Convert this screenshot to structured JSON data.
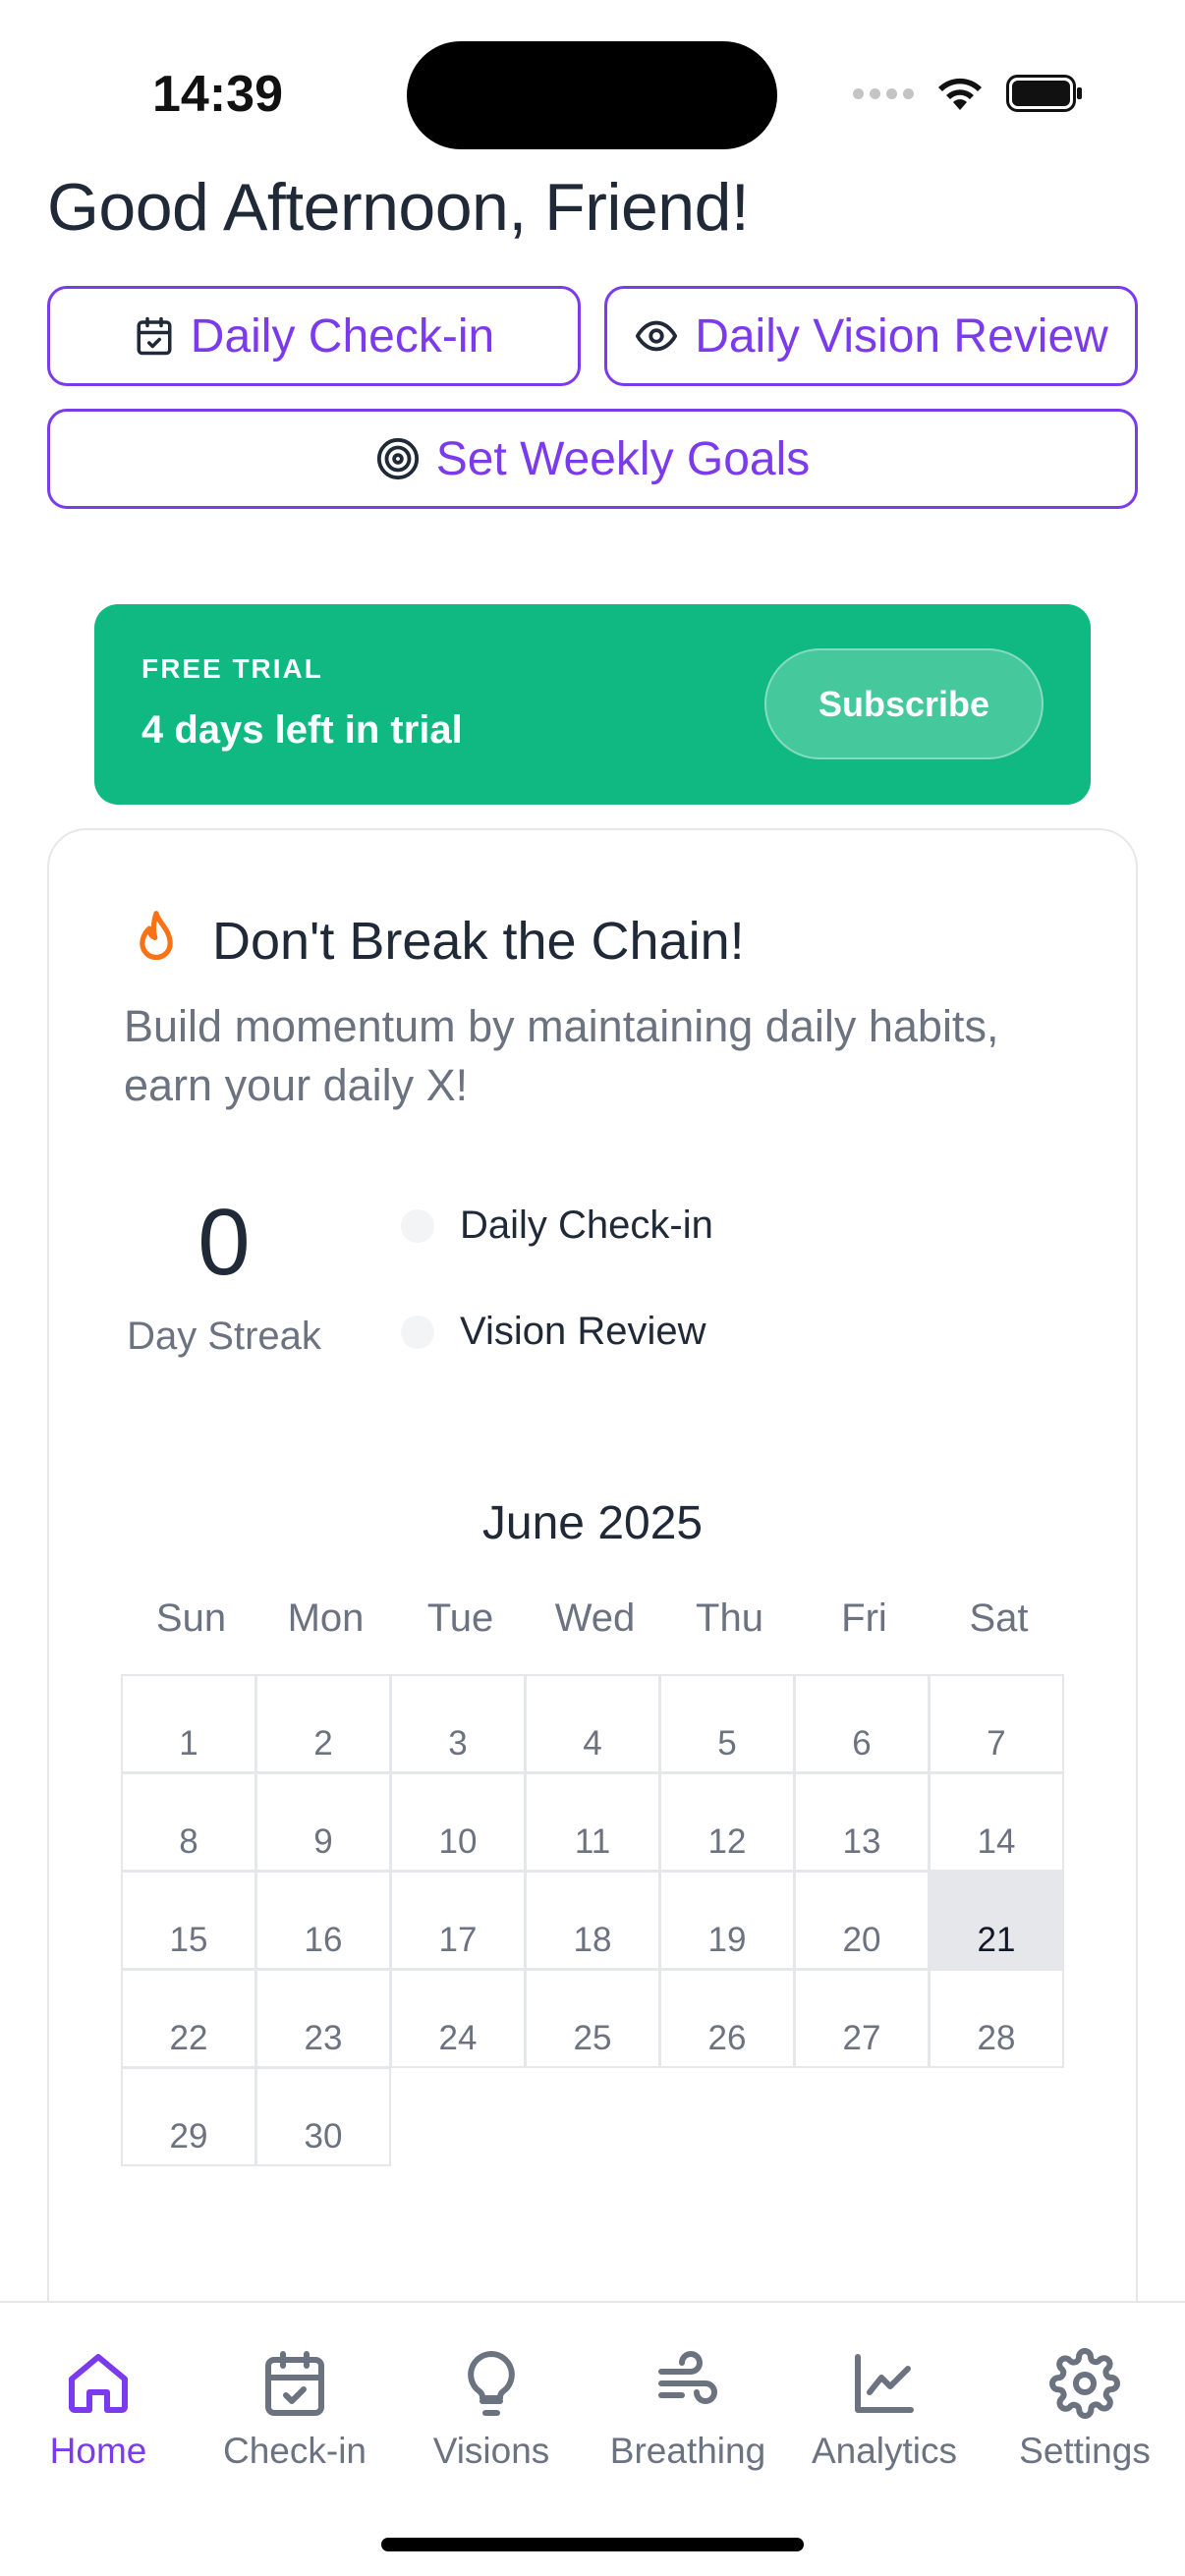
{
  "status_bar": {
    "time": "14:39"
  },
  "greeting": "Good Afternoon, Friend!",
  "actions": {
    "checkin": "Daily Check-in",
    "vision": "Daily Vision Review",
    "goals": "Set Weekly Goals"
  },
  "trial": {
    "label": "FREE TRIAL",
    "text": "4 days left in trial",
    "subscribe": "Subscribe",
    "color": "#10b981"
  },
  "chain_card": {
    "title": "Don't Break the Chain!",
    "subtitle": "Build momentum by maintaining daily habits, earn your daily X!",
    "streak_value": "0",
    "streak_label": "Day Streak",
    "habits": [
      "Daily Check-in",
      "Vision Review"
    ],
    "month": "June 2025",
    "weekdays": [
      "Sun",
      "Mon",
      "Tue",
      "Wed",
      "Thu",
      "Fri",
      "Sat"
    ],
    "days": [
      "1",
      "2",
      "3",
      "4",
      "5",
      "6",
      "7",
      "8",
      "9",
      "10",
      "11",
      "12",
      "13",
      "14",
      "15",
      "16",
      "17",
      "18",
      "19",
      "20",
      "21",
      "22",
      "23",
      "24",
      "25",
      "26",
      "27",
      "28",
      "29",
      "30"
    ],
    "today": "21"
  },
  "tabs": [
    {
      "label": "Home",
      "icon": "home-icon",
      "active": true
    },
    {
      "label": "Check-in",
      "icon": "calendar-check-icon",
      "active": false
    },
    {
      "label": "Visions",
      "icon": "lightbulb-icon",
      "active": false
    },
    {
      "label": "Breathing",
      "icon": "wind-icon",
      "active": false
    },
    {
      "label": "Analytics",
      "icon": "chart-line-icon",
      "active": false
    },
    {
      "label": "Settings",
      "icon": "gear-icon",
      "active": false
    }
  ],
  "colors": {
    "accent": "#7c3aed",
    "success": "#10b981",
    "flame": "#f97316"
  }
}
